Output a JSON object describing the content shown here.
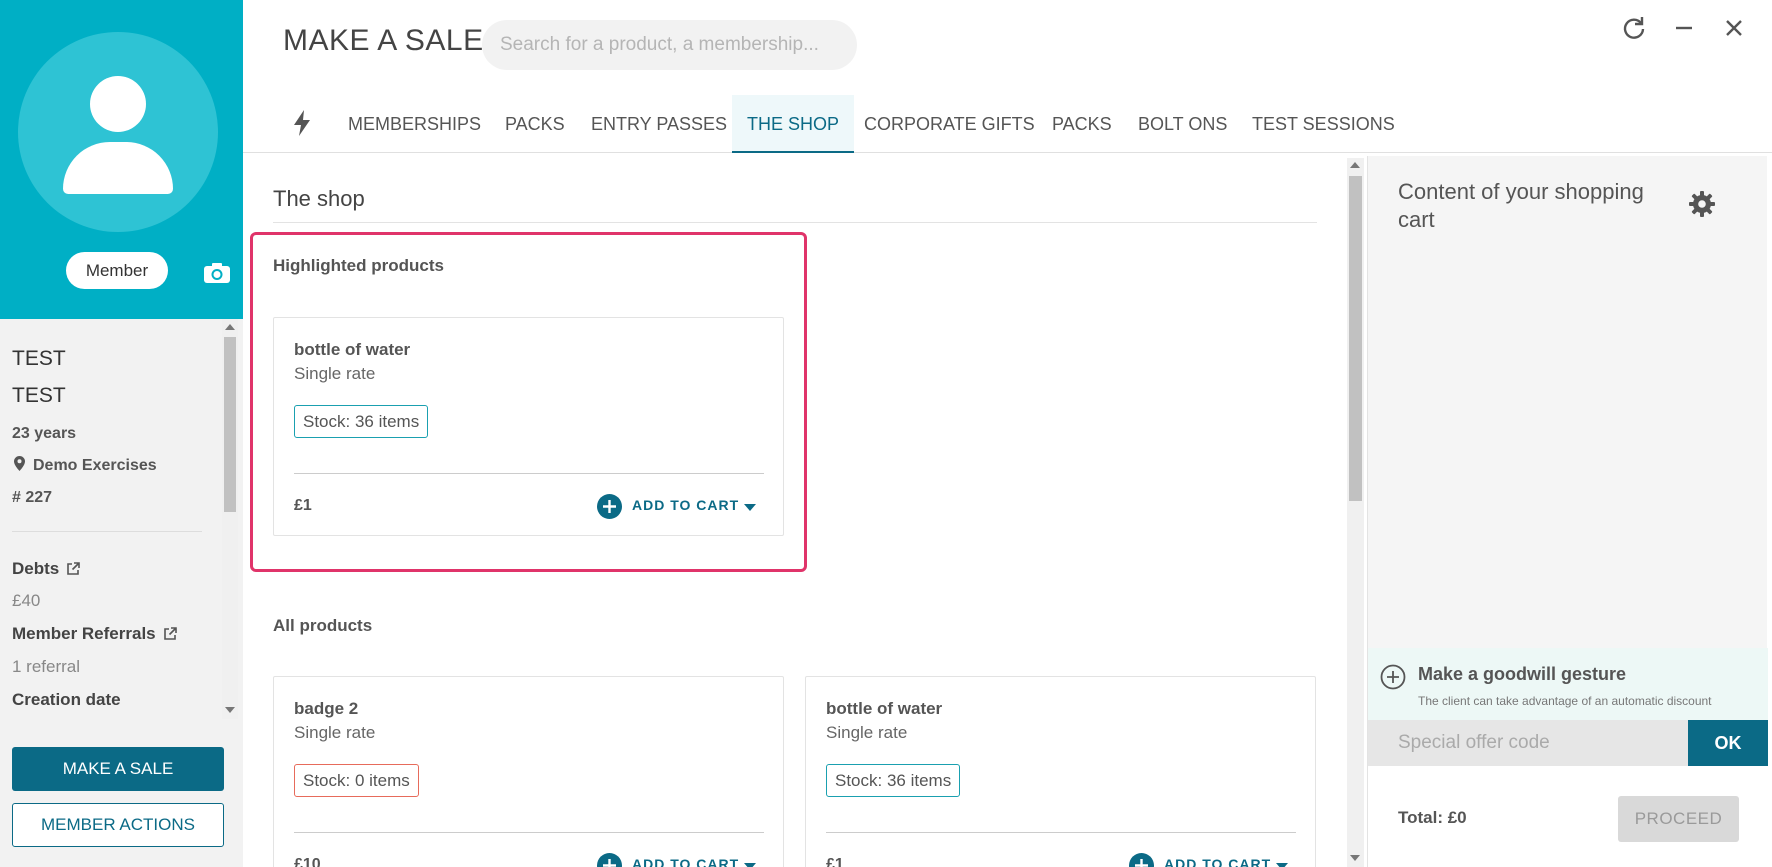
{
  "sidebar": {
    "member_badge": "Member",
    "first_name": "TEST",
    "last_name": "TEST",
    "age": "23 years",
    "location": "Demo Exercises",
    "member_number": "# 227",
    "debts_label": "Debts",
    "debts_value": "£40",
    "referrals_label": "Member Referrals",
    "referrals_value": "1 referral",
    "creation_label": "Creation date",
    "make_sale_label": "MAKE A SALE",
    "member_actions_label": "MEMBER ACTIONS"
  },
  "header": {
    "title": "MAKE A SALE",
    "search_placeholder": "Search for a product, a membership..."
  },
  "tabs": [
    {
      "label": "MEMBERSHIPS",
      "active": false
    },
    {
      "label": "PACKS",
      "active": false
    },
    {
      "label": "ENTRY PASSES",
      "active": false
    },
    {
      "label": "THE SHOP",
      "active": true
    },
    {
      "label": "CORPORATE GIFTS",
      "active": false
    },
    {
      "label": "PACKS",
      "active": false
    },
    {
      "label": "BOLT ONS",
      "active": false
    },
    {
      "label": "TEST SESSIONS",
      "active": false
    }
  ],
  "shop": {
    "title": "The shop",
    "highlighted_title": "Highlighted products",
    "all_title": "All products",
    "add_to_cart_label": "ADD TO CART",
    "highlighted": [
      {
        "name": "bottle of water",
        "rate": "Single rate",
        "stock": "Stock: 36 items",
        "price": "£1"
      }
    ],
    "all": [
      {
        "name": "badge 2",
        "rate": "Single rate",
        "stock": "Stock: 0 items",
        "price": "£10"
      },
      {
        "name": "bottle of water",
        "rate": "Single rate",
        "stock": "Stock: 36 items",
        "price": "£1"
      }
    ]
  },
  "cart": {
    "title": "Content of your shopping cart",
    "goodwill_title": "Make a goodwill gesture",
    "goodwill_sub": "The client can take advantage of an automatic discount",
    "offer_placeholder": "Special offer code",
    "ok_label": "OK",
    "total": "Total: £0",
    "proceed_label": "PROCEED"
  },
  "colors": {
    "primary": "#0b6a86",
    "profile_bg": "#00afc5",
    "highlight_border": "#e0346a"
  }
}
